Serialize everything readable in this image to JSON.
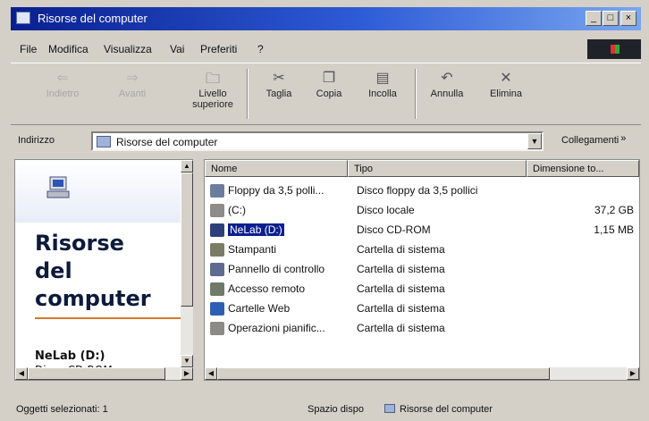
{
  "window": {
    "title": "Risorse del computer"
  },
  "menu": [
    "File",
    "Modifica",
    "Visualizza",
    "Vai",
    "Preferiti",
    "?"
  ],
  "toolbar": {
    "back": "Indietro",
    "forward": "Avanti",
    "up_line1": "Livello",
    "up_line2": "superiore",
    "cut": "Taglia",
    "copy": "Copia",
    "paste": "Incolla",
    "undo": "Annulla",
    "delete": "Elimina"
  },
  "address": {
    "label": "Indirizzo",
    "value": "Risorse del computer",
    "links": "Collegamenti",
    "links_chevron": "»"
  },
  "left_panel": {
    "title_line1": "Risorse",
    "title_line2": "del",
    "title_line3": "computer",
    "selected_name": "NeLab (D:)",
    "selected_type": "Disco CD-ROM"
  },
  "columns": {
    "name": "Nome",
    "type": "Tipo",
    "size": "Dimensione to..."
  },
  "rows": [
    {
      "name": "Floppy da 3,5 polli...",
      "type": "Disco floppy da 3,5 pollici",
      "size": "",
      "icon": "floppy-icon",
      "color": "#6d7d9e"
    },
    {
      "name": "(C:)",
      "type": "Disco locale",
      "size": "37,2 GB",
      "icon": "hard-disk-icon",
      "color": "#8e8c88"
    },
    {
      "name": "NeLab (D:)",
      "type": "Disco CD-ROM",
      "size": "1,15 MB",
      "icon": "cd-rom-icon",
      "color": "#2d3f7a"
    },
    {
      "name": "Stampanti",
      "type": "Cartella di sistema",
      "size": "",
      "icon": "printers-folder-icon",
      "color": "#7a7c66"
    },
    {
      "name": "Pannello di controllo",
      "type": "Cartella di sistema",
      "size": "",
      "icon": "control-panel-icon",
      "color": "#5f6b8e"
    },
    {
      "name": "Accesso remoto",
      "type": "Cartella di sistema",
      "size": "",
      "icon": "remote-access-icon",
      "color": "#6f7a6a"
    },
    {
      "name": "Cartelle Web",
      "type": "Cartella di sistema",
      "size": "",
      "icon": "web-folders-icon",
      "color": "#2f5fb5"
    },
    {
      "name": "Operazioni pianific...",
      "type": "Cartella di sistema",
      "size": "",
      "icon": "scheduled-tasks-icon",
      "color": "#8c8a84"
    }
  ],
  "status": {
    "left": "Oggetti selezionati: 1",
    "mid": "Spazio dispo",
    "right": "Risorse del computer"
  }
}
